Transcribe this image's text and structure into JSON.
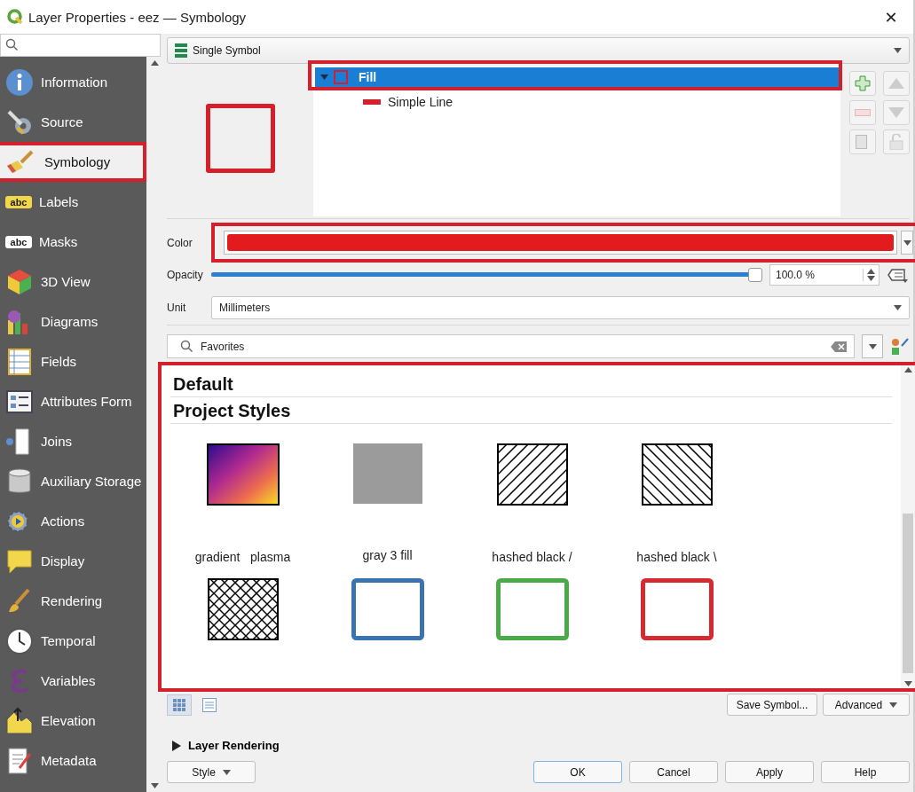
{
  "window": {
    "title": "Layer Properties - eez — Symbology",
    "close": "✕"
  },
  "sidebar": {
    "items": [
      {
        "label": "Information",
        "selected": false,
        "highlighted": false
      },
      {
        "label": "Source",
        "selected": false,
        "highlighted": false
      },
      {
        "label": "Symbology",
        "selected": true,
        "highlighted": true
      },
      {
        "label": "Labels",
        "badge": "abc",
        "selected": false,
        "highlighted": false
      },
      {
        "label": "Masks",
        "badge": "abc",
        "selected": false,
        "highlighted": false
      },
      {
        "label": "3D View",
        "selected": false,
        "highlighted": false
      },
      {
        "label": "Diagrams",
        "selected": false,
        "highlighted": false
      },
      {
        "label": "Fields",
        "selected": false,
        "highlighted": false
      },
      {
        "label": "Attributes Form",
        "selected": false,
        "highlighted": false
      },
      {
        "label": "Joins",
        "selected": false,
        "highlighted": false
      },
      {
        "label": "Auxiliary Storage",
        "selected": false,
        "highlighted": false
      },
      {
        "label": "Actions",
        "selected": false,
        "highlighted": false
      },
      {
        "label": "Display",
        "selected": false,
        "highlighted": false
      },
      {
        "label": "Rendering",
        "selected": false,
        "highlighted": false
      },
      {
        "label": "Temporal",
        "selected": false,
        "highlighted": false
      },
      {
        "label": "Variables",
        "selected": false,
        "highlighted": false
      },
      {
        "label": "Elevation",
        "selected": false,
        "highlighted": false
      },
      {
        "label": "Metadata",
        "selected": false,
        "highlighted": false
      }
    ]
  },
  "renderer": {
    "value": "Single Symbol"
  },
  "layer_tree": {
    "highlighted": true,
    "items": [
      {
        "label": "Fill",
        "selected": true,
        "expanded": true,
        "children": [
          {
            "label": "Simple Line",
            "selected": false
          }
        ]
      }
    ]
  },
  "color": {
    "label": "Color",
    "highlighted": true,
    "swatch": {
      "color": "#e21b1f"
    }
  },
  "opacity": {
    "label": "Opacity",
    "level": 1.0,
    "reading": "100.0 %"
  },
  "unit": {
    "label": "Unit",
    "value": "Millimeters"
  },
  "library_search": {
    "value": "Favorites"
  },
  "library": {
    "highlighted": true,
    "groups": [
      {
        "title": "Default"
      },
      {
        "title": "Project Styles"
      }
    ],
    "symbols": [
      {
        "kind": "gradient",
        "label": "gradient   plasma"
      },
      {
        "kind": "solid",
        "label": "gray 3 fill",
        "color": "#9b9b9b"
      },
      {
        "kind": "hatch-forward",
        "label": "hashed black /"
      },
      {
        "kind": "hatch-back",
        "label": "hashed black \\"
      },
      {
        "kind": "crosshatch"
      },
      {
        "kind": "outline",
        "color": "#3b73b0"
      },
      {
        "kind": "outline",
        "color": "#4aaa48"
      },
      {
        "kind": "outline",
        "color": "#d52a2f"
      }
    ]
  },
  "library_views": [
    {
      "kind": "grid",
      "selected": true
    },
    {
      "kind": "list",
      "selected": false
    }
  ],
  "buttons_right": [
    "Save Symbol...",
    "Advanced"
  ],
  "layer_rendering": {
    "label": "Layer Rendering",
    "expanded": false
  },
  "footer": {
    "style": "Style",
    "buttons": [
      "OK",
      "Cancel",
      "Apply",
      "Help"
    ]
  }
}
